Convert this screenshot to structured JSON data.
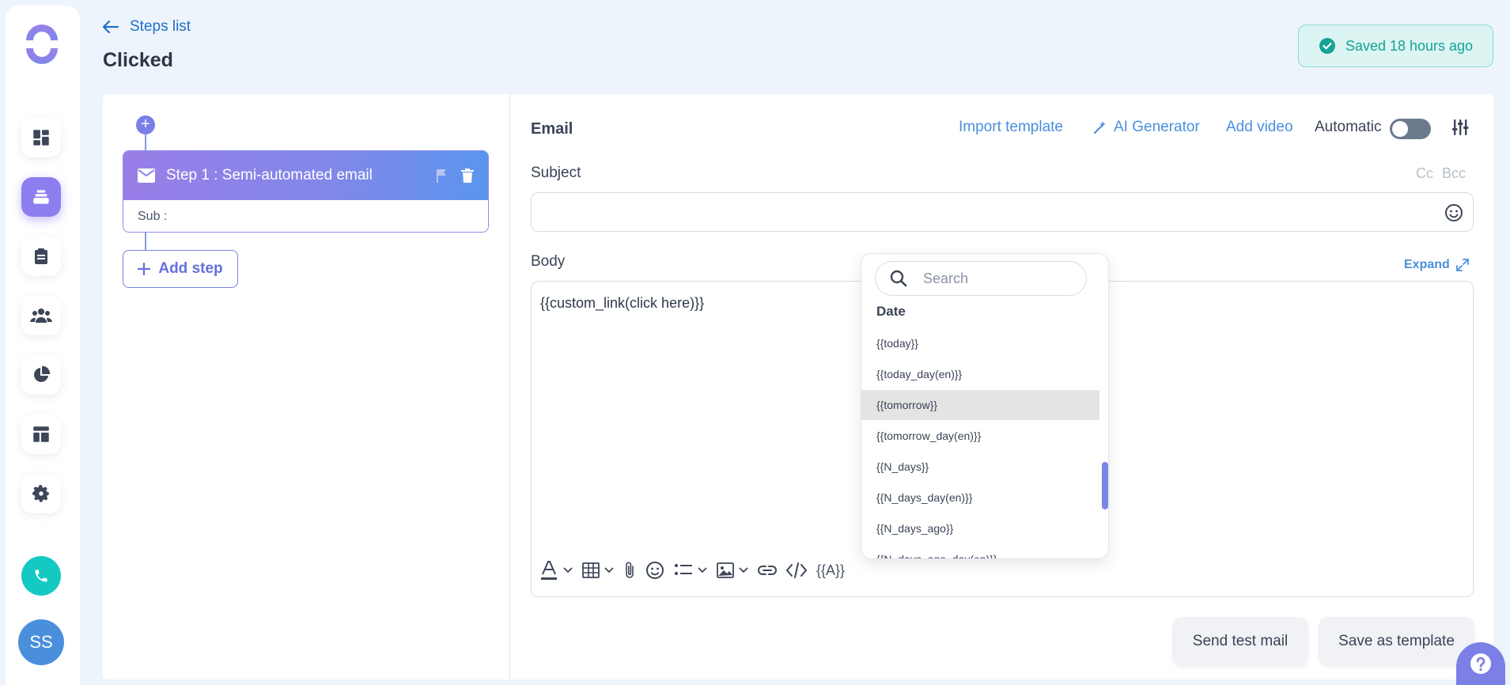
{
  "header": {
    "back_label": "Steps list",
    "title": "Clicked",
    "saved_status": "Saved 18 hours ago"
  },
  "sidebar": {
    "avatar_initials": "SS",
    "nav_icons": [
      "dashboard-icon",
      "campaigns-icon",
      "clipboard-icon",
      "contacts-icon",
      "reports-icon",
      "templates-icon",
      "settings-icon"
    ],
    "active_index": 1
  },
  "steps": {
    "step_title": "Step 1 : Semi-automated email",
    "step_sub": "Sub :",
    "add_step_label": "Add step"
  },
  "email": {
    "section_label": "Email",
    "import_template": "Import template",
    "ai_generator": "AI Generator",
    "add_video": "Add video",
    "automatic_label": "Automatic",
    "automatic_on": false,
    "subject_label": "Subject",
    "subject_value": "",
    "cc_label": "Cc",
    "bcc_label": "Bcc",
    "body_label": "Body",
    "expand_label": "Expand",
    "body_text": "{{custom_link(click here)}}",
    "variable_button": "{{A}}"
  },
  "variables_dropdown": {
    "search_placeholder": "Search",
    "group_label": "Date",
    "items": [
      "{{today}}",
      "{{today_day(en)}}",
      "{{tomorrow}}",
      "{{tomorrow_day(en)}}",
      "{{N_days}}",
      "{{N_days_day(en)}}",
      "{{N_days_ago}}",
      "{{N_days_ago_day(en)}}"
    ],
    "highlighted_index": 2
  },
  "actions": {
    "send_test": "Send test mail",
    "save_template": "Save as template"
  },
  "colors": {
    "accent": "#7b7fe6",
    "link": "#4a8fdc",
    "success": "#16a396"
  }
}
